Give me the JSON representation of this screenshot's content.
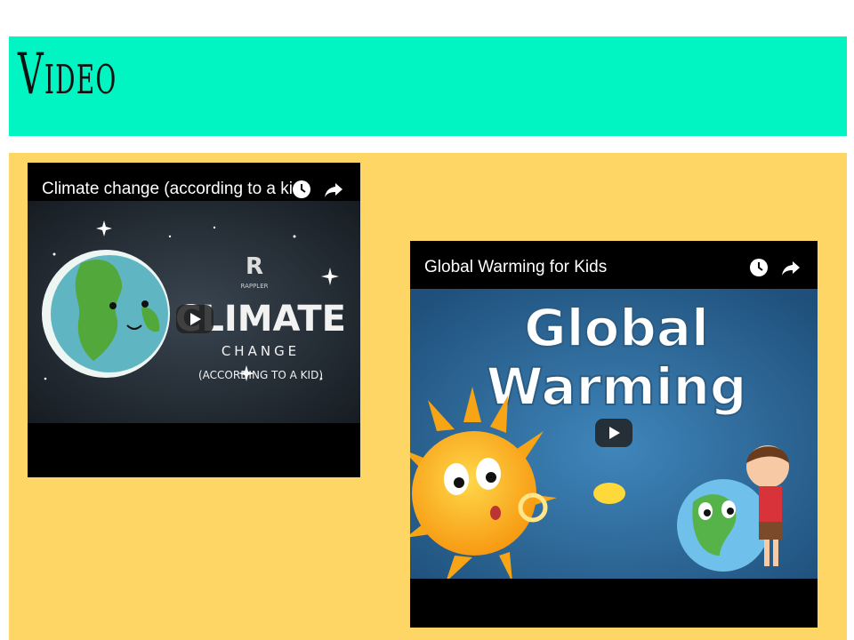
{
  "slide": {
    "title": "Video"
  },
  "colors": {
    "header_band": "#00f5c3",
    "content_panel": "#fed665",
    "video_frame": "#000000"
  },
  "videos": [
    {
      "title": "Climate change (according to a kid)",
      "thumbnail_text": {
        "brand": "RAPPLER",
        "headline": "CLIMATE",
        "subline": "CHANGE",
        "tagline": "(ACCORDING TO A KID)"
      },
      "icons": [
        "clock-icon",
        "share-icon",
        "play-icon"
      ]
    },
    {
      "title": "Global Warming for Kids",
      "thumbnail_text": {
        "line1": "Global",
        "line2": "Warming"
      },
      "icons": [
        "clock-icon",
        "share-icon",
        "play-icon"
      ]
    }
  ]
}
